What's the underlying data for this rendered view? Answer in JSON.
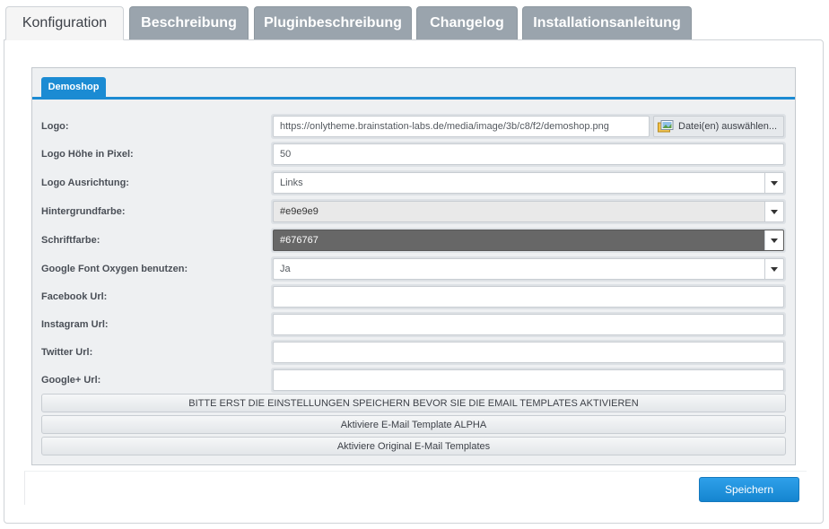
{
  "tabs": [
    {
      "label": "Konfiguration"
    },
    {
      "label": "Beschreibung"
    },
    {
      "label": "Pluginbeschreibung"
    },
    {
      "label": "Changelog"
    },
    {
      "label": "Installationsanleitung"
    }
  ],
  "shop_tab": {
    "label": "Demoshop"
  },
  "fields": {
    "logo": {
      "label": "Logo:",
      "value": "https://onlytheme.brainstation-labs.de/media/image/3b/c8/f2/demoshop.png",
      "file_button": "Datei(en) auswählen..."
    },
    "logo_height": {
      "label": "Logo Höhe in Pixel:",
      "value": "50"
    },
    "logo_align": {
      "label": "Logo Ausrichtung:",
      "value": "Links"
    },
    "bg_color": {
      "label": "Hintergrundfarbe:",
      "value": "#e9e9e9"
    },
    "font_color": {
      "label": "Schriftfarbe:",
      "value": "#676767"
    },
    "google_font": {
      "label": "Google Font Oxygen benutzen:",
      "value": "Ja"
    },
    "facebook": {
      "label": "Facebook Url:",
      "value": ""
    },
    "instagram": {
      "label": "Instagram Url:",
      "value": ""
    },
    "twitter": {
      "label": "Twitter Url:",
      "value": ""
    },
    "googleplus": {
      "label": "Google+ Url:",
      "value": ""
    }
  },
  "buttons": {
    "warning": "BITTE ERST DIE EINSTELLUNGEN SPEICHERN BEVOR SIE DIE EMAIL TEMPLATES AKTIVIEREN",
    "alpha": "Aktiviere E-Mail Template ALPHA",
    "original": "Aktiviere Original E-Mail Templates",
    "save": "Speichern"
  },
  "colors": {
    "accent": "#1b8bd3",
    "tab_inactive": "#9aa4ad",
    "bg_swatch": "#e9e9e9",
    "font_swatch": "#676767"
  }
}
